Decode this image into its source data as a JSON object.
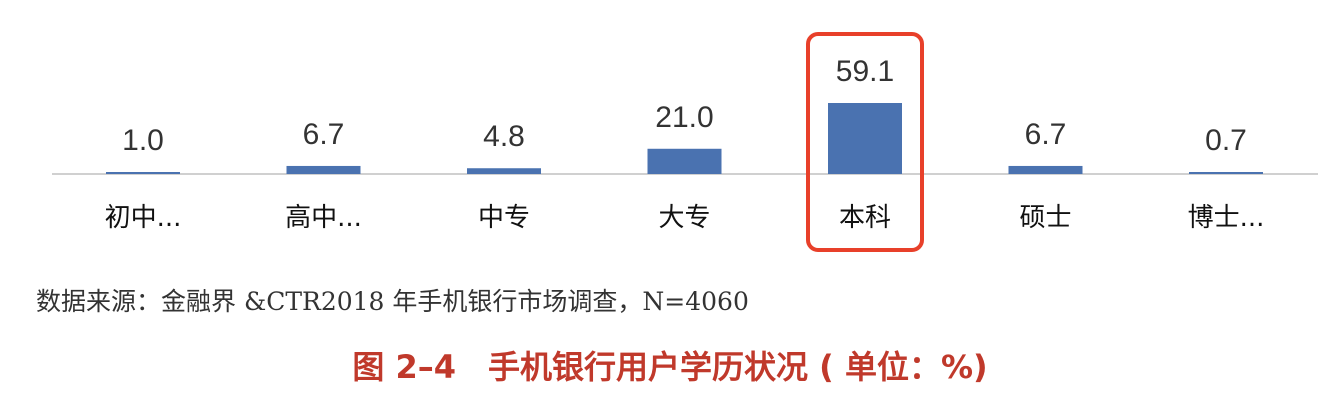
{
  "chart_data": {
    "type": "bar",
    "categories": [
      "初中...",
      "高中...",
      "中专",
      "大专",
      "本科",
      "硕士",
      "博士..."
    ],
    "values": [
      1.0,
      6.7,
      4.8,
      21.0,
      59.1,
      6.7,
      0.7
    ],
    "value_labels": [
      "1.0",
      "6.7",
      "4.8",
      "21.0",
      "59.1",
      "6.7",
      "0.7"
    ],
    "highlighted_category": "本科",
    "bar_color": "#4a72b0",
    "highlight_color": "#e8402a",
    "axis_color": "#d0d0d0"
  },
  "source_text": "数据来源：金融界 &CTR2018 年手机银行市场调查，N=4060",
  "caption": "图 2–4　手机银行用户学历状况 ( 单位：%)"
}
